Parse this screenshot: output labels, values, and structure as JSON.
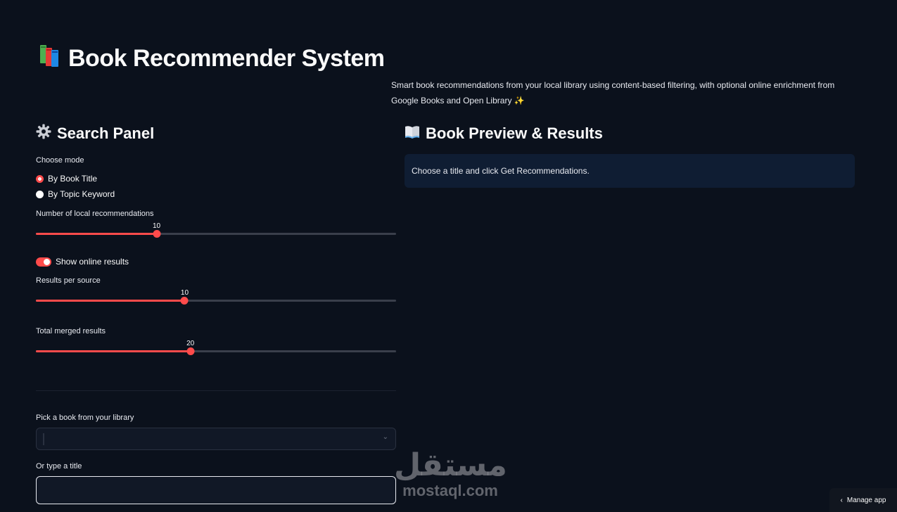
{
  "app": {
    "title": "Book Recommender System",
    "title_icon": "books-icon",
    "description": "Smart book recommendations from your local library using content-based filtering, with optional online enrichment from Google Books and Open Library ✨"
  },
  "search_panel": {
    "title": "Search Panel",
    "icon": "gear-icon",
    "mode_label": "Choose mode",
    "modes": [
      {
        "label": "By Book Title",
        "selected": true
      },
      {
        "label": "By Topic Keyword",
        "selected": false
      }
    ],
    "sliders": [
      {
        "label": "Number of local recommendations",
        "value": "10",
        "fraction": 0.335
      },
      {
        "label": "Results per source",
        "value": "10",
        "fraction": 0.413
      },
      {
        "label": "Total merged results",
        "value": "20",
        "fraction": 0.429
      }
    ],
    "toggle": {
      "label": "Show online results",
      "on": true
    },
    "pick_label": "Pick a book from your library",
    "pick_value": "",
    "type_label": "Or type a title",
    "type_value": ""
  },
  "results": {
    "title": "Book Preview & Results",
    "icon": "open-book-icon",
    "info": "Choose a title and click Get Recommendations."
  },
  "footer": {
    "manage_app": "Manage app"
  },
  "watermark": {
    "arabic": "مستقل",
    "latin": "mostaql.com"
  },
  "colors": {
    "accent": "#ff4b4b",
    "background": "#0b111c",
    "info_bg": "#0f1d33"
  }
}
